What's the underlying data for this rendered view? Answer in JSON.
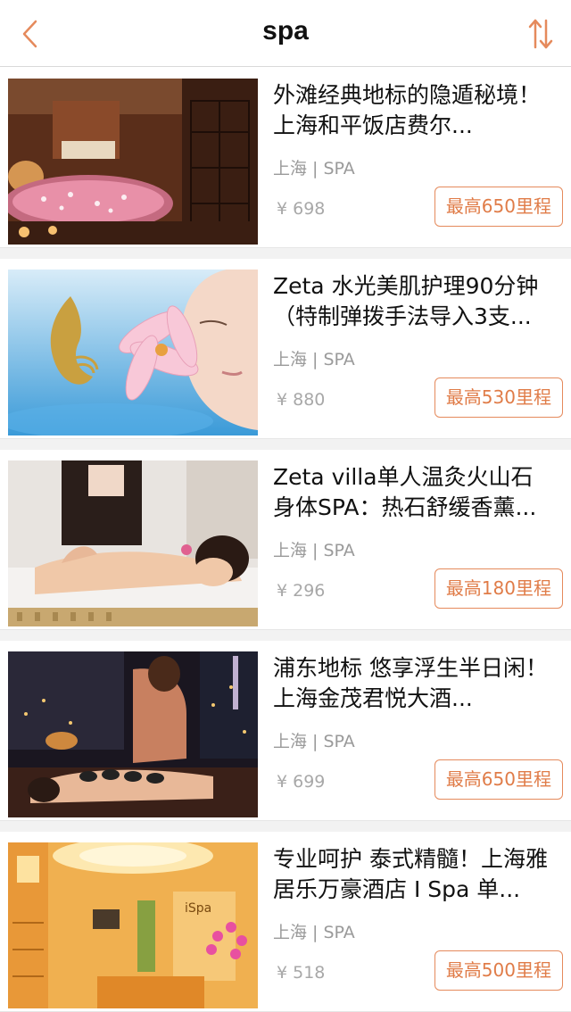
{
  "navbar": {
    "title": "spa",
    "back_icon": "chevron-left-icon",
    "sort_icon": "sort-arrows-icon",
    "accent_color": "#e58a5c"
  },
  "items": [
    {
      "title": "外滩经典地标的隐遁秘境！上海和平饭店费尔...",
      "meta": "上海 | SPA",
      "price": "¥ 698",
      "miles": "最高650里程",
      "image": "spa-room-bathtub"
    },
    {
      "title": "Zeta 水光美肌护理90分钟（特制弹拨手法导入3支...",
      "meta": "上海 | SPA",
      "price": "¥ 880",
      "miles": "最高530里程",
      "image": "face-with-lily"
    },
    {
      "title": "Zeta villa单人温灸火山石身体SPA：热石舒缓香薰...",
      "meta": "上海 | SPA",
      "price": "¥ 296",
      "miles": "最高180里程",
      "image": "back-massage"
    },
    {
      "title": "浦东地标 悠享浮生半日闲！上海金茂君悦大酒...",
      "meta": "上海 | SPA",
      "price": "¥ 699",
      "miles": "最高650里程",
      "image": "hot-stone-night-view"
    },
    {
      "title": "专业呵护 泰式精髓！上海雅居乐万豪酒店 I Spa 单...",
      "meta": "上海 | SPA",
      "price": "¥ 518",
      "miles": "最高500里程",
      "image": "ispa-lobby"
    }
  ]
}
